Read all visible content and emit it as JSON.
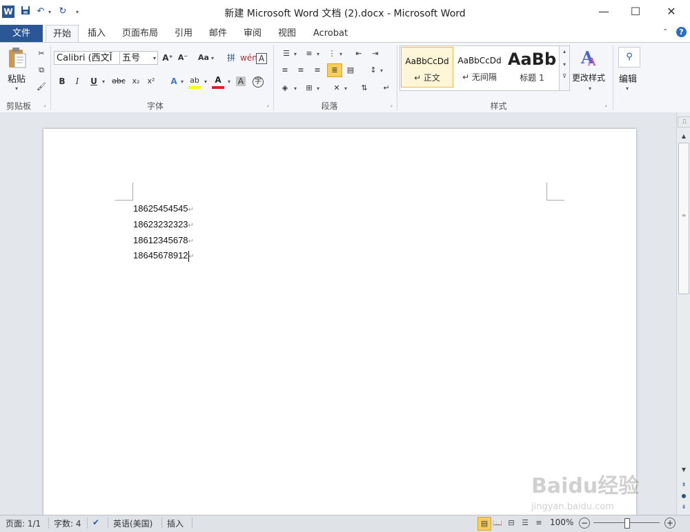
{
  "window": {
    "title": "新建 Microsoft Word 文档 (2).docx - Microsoft Word",
    "app_icon": "W",
    "quick_access": [
      "save-icon",
      "undo-icon",
      "redo-icon",
      "customize-icon"
    ],
    "controls": {
      "minimize": "—",
      "maximize": "☐",
      "close": "✕"
    }
  },
  "tabs": {
    "file": "文件",
    "items": [
      "开始",
      "插入",
      "页面布局",
      "引用",
      "邮件",
      "审阅",
      "视图",
      "Acrobat"
    ]
  },
  "ribbon": {
    "clipboard": {
      "label": "剪贴板",
      "paste": "粘贴"
    },
    "font": {
      "label": "字体",
      "font_name": "Calibri (西文Ī",
      "font_size": "五号",
      "grow": "A⁺",
      "shrink": "A⁻",
      "case": "Aa",
      "bold": "B",
      "italic": "I",
      "underline": "U",
      "strike": "abc",
      "sub": "x₂",
      "sup": "x²",
      "highlight_color": "#ffff00",
      "font_color": "#e02020"
    },
    "paragraph": {
      "label": "段落"
    },
    "styles": {
      "label": "样式",
      "items": [
        {
          "sample": "AaBbCcDd",
          "name": "↵ 正文"
        },
        {
          "sample": "AaBbCcDd",
          "name": "↵ 无间隔"
        },
        {
          "sample": "AaBb",
          "name": "标题 1"
        }
      ],
      "change_styles": "更改样式"
    },
    "editing": {
      "label": "编辑"
    }
  },
  "document": {
    "lines": [
      "18625454545",
      "18623232323",
      "18612345678",
      "18645678912"
    ]
  },
  "status": {
    "page": "页面: 1/1",
    "words": "字数: 4",
    "language": "英语(美国)",
    "mode": "插入",
    "zoom": "100%",
    "zoom_level": 0.5
  },
  "watermark": {
    "brand": "Baidu经验",
    "url": "jingyan.baidu.com"
  },
  "colors": {
    "file_tab": "#2b5797",
    "accent": "#1f4e96"
  }
}
